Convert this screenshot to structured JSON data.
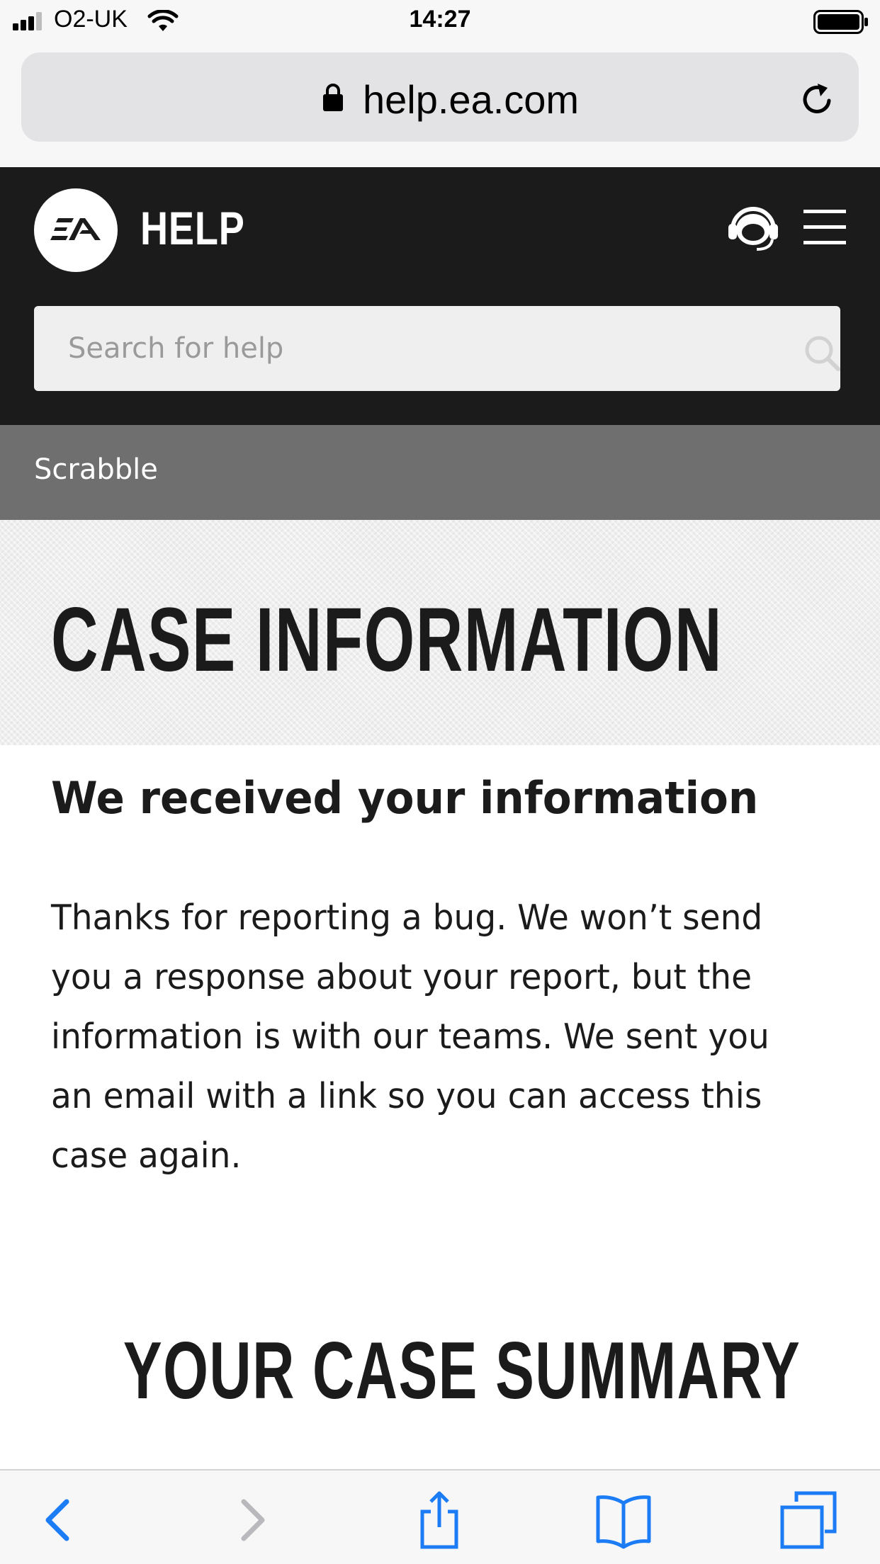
{
  "status_bar": {
    "carrier": "O2-UK",
    "time": "14:27"
  },
  "url_bar": {
    "domain": "help.ea.com"
  },
  "header": {
    "logo_text": "EA",
    "title": "HELP",
    "search_placeholder": "Search for help"
  },
  "breadcrumb": {
    "label": "Scrabble"
  },
  "page": {
    "title": "CASE INFORMATION",
    "received_heading": "We received your information",
    "body": "Thanks for reporting a bug. We won’t send you a response about your report, but the information is with our teams. We sent you an email with a link so you can access this case again.",
    "summary_title": "YOUR CASE SUMMARY"
  },
  "colors": {
    "header_bg": "#1b1b1b",
    "breadcrumb_bg": "#6f6f70",
    "toolbar_accent": "#1b7cf6",
    "toolbar_disabled": "#b8b8bd"
  },
  "icons": {
    "status": [
      "signal-icon",
      "wifi-icon",
      "battery-icon"
    ],
    "url_bar": [
      "lock-icon",
      "reload-icon"
    ],
    "header": [
      "headset-icon",
      "menu-icon",
      "search-icon"
    ],
    "toolbar": [
      "back-icon",
      "forward-icon",
      "share-icon",
      "bookmarks-icon",
      "tabs-icon"
    ]
  }
}
